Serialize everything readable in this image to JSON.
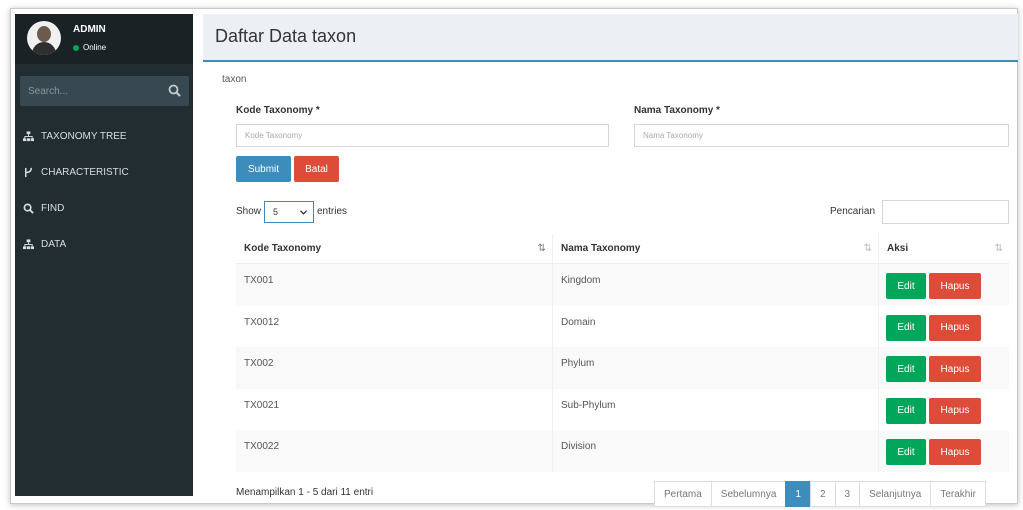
{
  "user": {
    "name": "ADMIN",
    "status": "Online"
  },
  "sidebar": {
    "search_placeholder": "Search...",
    "items": [
      {
        "label": "TAXONOMY TREE",
        "icon": "sitemap-icon"
      },
      {
        "label": "CHARACTERISTIC",
        "icon": "code-fork-icon"
      },
      {
        "label": "FIND",
        "icon": "search-icon"
      },
      {
        "label": "DATA",
        "icon": "sitemap-icon"
      }
    ]
  },
  "page": {
    "title": "Daftar Data taxon",
    "breadcrumb": "taxon"
  },
  "form": {
    "kode_label": "Kode Taxonomy *",
    "kode_placeholder": "Kode Taxonomy",
    "nama_label": "Nama Taxonomy *",
    "nama_placeholder": "Nama Taxonomy",
    "submit": "Submit",
    "batal": "Batal"
  },
  "table_controls": {
    "show": "Show",
    "entries_value": "5",
    "entries": "entries",
    "search_label": "Pencarian"
  },
  "table": {
    "headers": [
      "Kode Taxonomy",
      "Nama Taxonomy",
      "Aksi"
    ],
    "rows": [
      {
        "kode": "TX001",
        "nama": "Kingdom"
      },
      {
        "kode": "TX0012",
        "nama": "Domain"
      },
      {
        "kode": "TX002",
        "nama": "Phylum"
      },
      {
        "kode": "TX0021",
        "nama": "Sub-Phylum"
      },
      {
        "kode": "TX0022",
        "nama": "Division"
      }
    ],
    "edit": "Edit",
    "hapus": "Hapus"
  },
  "footer": {
    "info": "Menampilkan 1 - 5 dari 11 entri",
    "pagination": [
      "Pertama",
      "Sebelumnya",
      "1",
      "2",
      "3",
      "Selanjutnya",
      "Terakhir"
    ],
    "active_page": "1"
  },
  "colors": {
    "sidebar": "#222d32",
    "primary": "#3c8dbc",
    "danger": "#dd4b39",
    "success": "#00a65a"
  }
}
